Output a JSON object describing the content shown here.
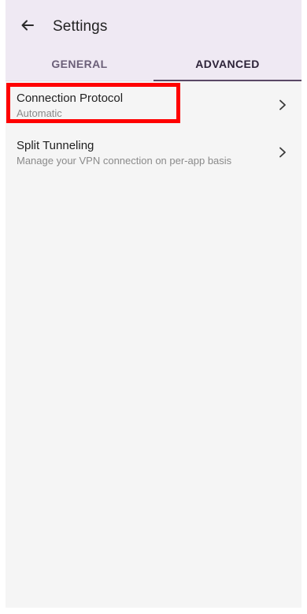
{
  "header": {
    "title": "Settings",
    "back_icon": "arrow-left-icon"
  },
  "tabs": [
    {
      "label": "GENERAL",
      "selected": false
    },
    {
      "label": "ADVANCED",
      "selected": true
    }
  ],
  "items": [
    {
      "title": "Connection Protocol",
      "subtitle": "Automatic",
      "icon": "chevron-right-icon"
    },
    {
      "title": "Split Tunneling",
      "subtitle": "Manage your VPN connection on per-app basis",
      "icon": "chevron-right-icon"
    }
  ],
  "colors": {
    "header_bg": "#efe9f3",
    "page_bg": "#f5f5f5",
    "highlight": "#ff0000",
    "accent": "#5a4866"
  }
}
